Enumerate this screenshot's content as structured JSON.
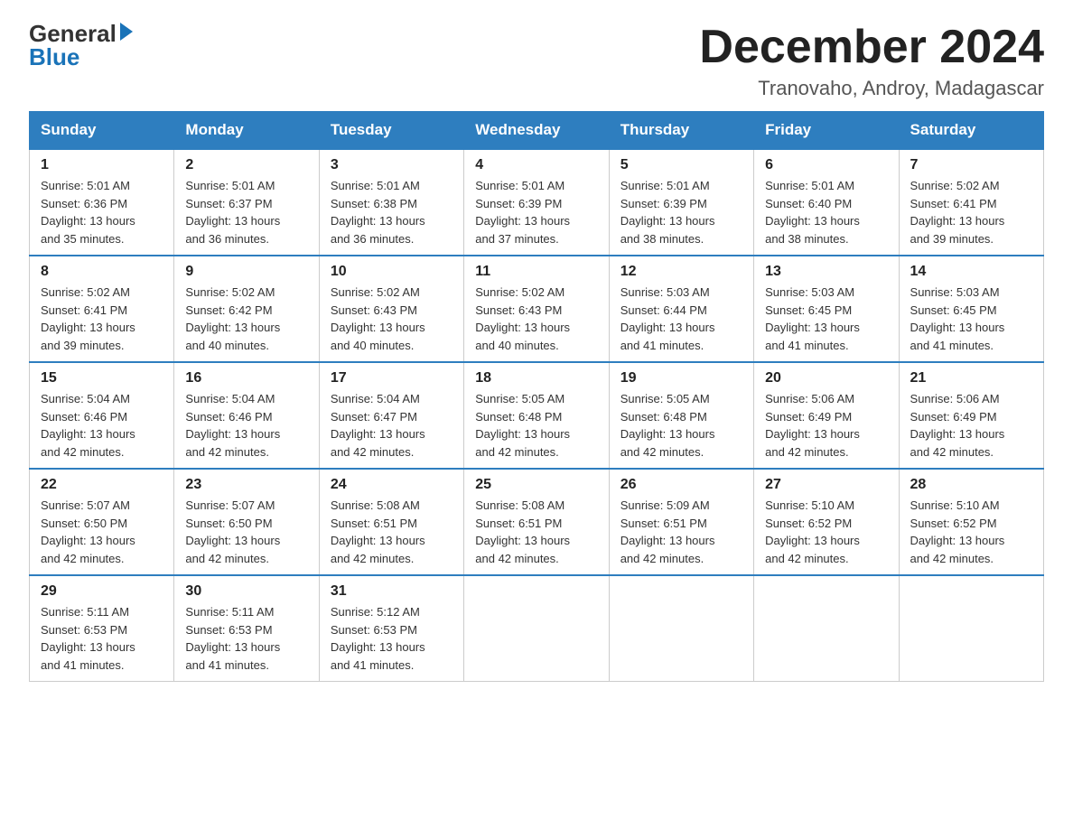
{
  "logo": {
    "general": "General",
    "blue": "Blue"
  },
  "title": {
    "month_year": "December 2024",
    "location": "Tranovaho, Androy, Madagascar"
  },
  "weekdays": [
    "Sunday",
    "Monday",
    "Tuesday",
    "Wednesday",
    "Thursday",
    "Friday",
    "Saturday"
  ],
  "weeks": [
    [
      {
        "day": "1",
        "sunrise": "5:01 AM",
        "sunset": "6:36 PM",
        "daylight": "13 hours and 35 minutes."
      },
      {
        "day": "2",
        "sunrise": "5:01 AM",
        "sunset": "6:37 PM",
        "daylight": "13 hours and 36 minutes."
      },
      {
        "day": "3",
        "sunrise": "5:01 AM",
        "sunset": "6:38 PM",
        "daylight": "13 hours and 36 minutes."
      },
      {
        "day": "4",
        "sunrise": "5:01 AM",
        "sunset": "6:39 PM",
        "daylight": "13 hours and 37 minutes."
      },
      {
        "day": "5",
        "sunrise": "5:01 AM",
        "sunset": "6:39 PM",
        "daylight": "13 hours and 38 minutes."
      },
      {
        "day": "6",
        "sunrise": "5:01 AM",
        "sunset": "6:40 PM",
        "daylight": "13 hours and 38 minutes."
      },
      {
        "day": "7",
        "sunrise": "5:02 AM",
        "sunset": "6:41 PM",
        "daylight": "13 hours and 39 minutes."
      }
    ],
    [
      {
        "day": "8",
        "sunrise": "5:02 AM",
        "sunset": "6:41 PM",
        "daylight": "13 hours and 39 minutes."
      },
      {
        "day": "9",
        "sunrise": "5:02 AM",
        "sunset": "6:42 PM",
        "daylight": "13 hours and 40 minutes."
      },
      {
        "day": "10",
        "sunrise": "5:02 AM",
        "sunset": "6:43 PM",
        "daylight": "13 hours and 40 minutes."
      },
      {
        "day": "11",
        "sunrise": "5:02 AM",
        "sunset": "6:43 PM",
        "daylight": "13 hours and 40 minutes."
      },
      {
        "day": "12",
        "sunrise": "5:03 AM",
        "sunset": "6:44 PM",
        "daylight": "13 hours and 41 minutes."
      },
      {
        "day": "13",
        "sunrise": "5:03 AM",
        "sunset": "6:45 PM",
        "daylight": "13 hours and 41 minutes."
      },
      {
        "day": "14",
        "sunrise": "5:03 AM",
        "sunset": "6:45 PM",
        "daylight": "13 hours and 41 minutes."
      }
    ],
    [
      {
        "day": "15",
        "sunrise": "5:04 AM",
        "sunset": "6:46 PM",
        "daylight": "13 hours and 42 minutes."
      },
      {
        "day": "16",
        "sunrise": "5:04 AM",
        "sunset": "6:46 PM",
        "daylight": "13 hours and 42 minutes."
      },
      {
        "day": "17",
        "sunrise": "5:04 AM",
        "sunset": "6:47 PM",
        "daylight": "13 hours and 42 minutes."
      },
      {
        "day": "18",
        "sunrise": "5:05 AM",
        "sunset": "6:48 PM",
        "daylight": "13 hours and 42 minutes."
      },
      {
        "day": "19",
        "sunrise": "5:05 AM",
        "sunset": "6:48 PM",
        "daylight": "13 hours and 42 minutes."
      },
      {
        "day": "20",
        "sunrise": "5:06 AM",
        "sunset": "6:49 PM",
        "daylight": "13 hours and 42 minutes."
      },
      {
        "day": "21",
        "sunrise": "5:06 AM",
        "sunset": "6:49 PM",
        "daylight": "13 hours and 42 minutes."
      }
    ],
    [
      {
        "day": "22",
        "sunrise": "5:07 AM",
        "sunset": "6:50 PM",
        "daylight": "13 hours and 42 minutes."
      },
      {
        "day": "23",
        "sunrise": "5:07 AM",
        "sunset": "6:50 PM",
        "daylight": "13 hours and 42 minutes."
      },
      {
        "day": "24",
        "sunrise": "5:08 AM",
        "sunset": "6:51 PM",
        "daylight": "13 hours and 42 minutes."
      },
      {
        "day": "25",
        "sunrise": "5:08 AM",
        "sunset": "6:51 PM",
        "daylight": "13 hours and 42 minutes."
      },
      {
        "day": "26",
        "sunrise": "5:09 AM",
        "sunset": "6:51 PM",
        "daylight": "13 hours and 42 minutes."
      },
      {
        "day": "27",
        "sunrise": "5:10 AM",
        "sunset": "6:52 PM",
        "daylight": "13 hours and 42 minutes."
      },
      {
        "day": "28",
        "sunrise": "5:10 AM",
        "sunset": "6:52 PM",
        "daylight": "13 hours and 42 minutes."
      }
    ],
    [
      {
        "day": "29",
        "sunrise": "5:11 AM",
        "sunset": "6:53 PM",
        "daylight": "13 hours and 41 minutes."
      },
      {
        "day": "30",
        "sunrise": "5:11 AM",
        "sunset": "6:53 PM",
        "daylight": "13 hours and 41 minutes."
      },
      {
        "day": "31",
        "sunrise": "5:12 AM",
        "sunset": "6:53 PM",
        "daylight": "13 hours and 41 minutes."
      },
      null,
      null,
      null,
      null
    ]
  ],
  "labels": {
    "sunrise": "Sunrise:",
    "sunset": "Sunset:",
    "daylight": "Daylight:"
  }
}
